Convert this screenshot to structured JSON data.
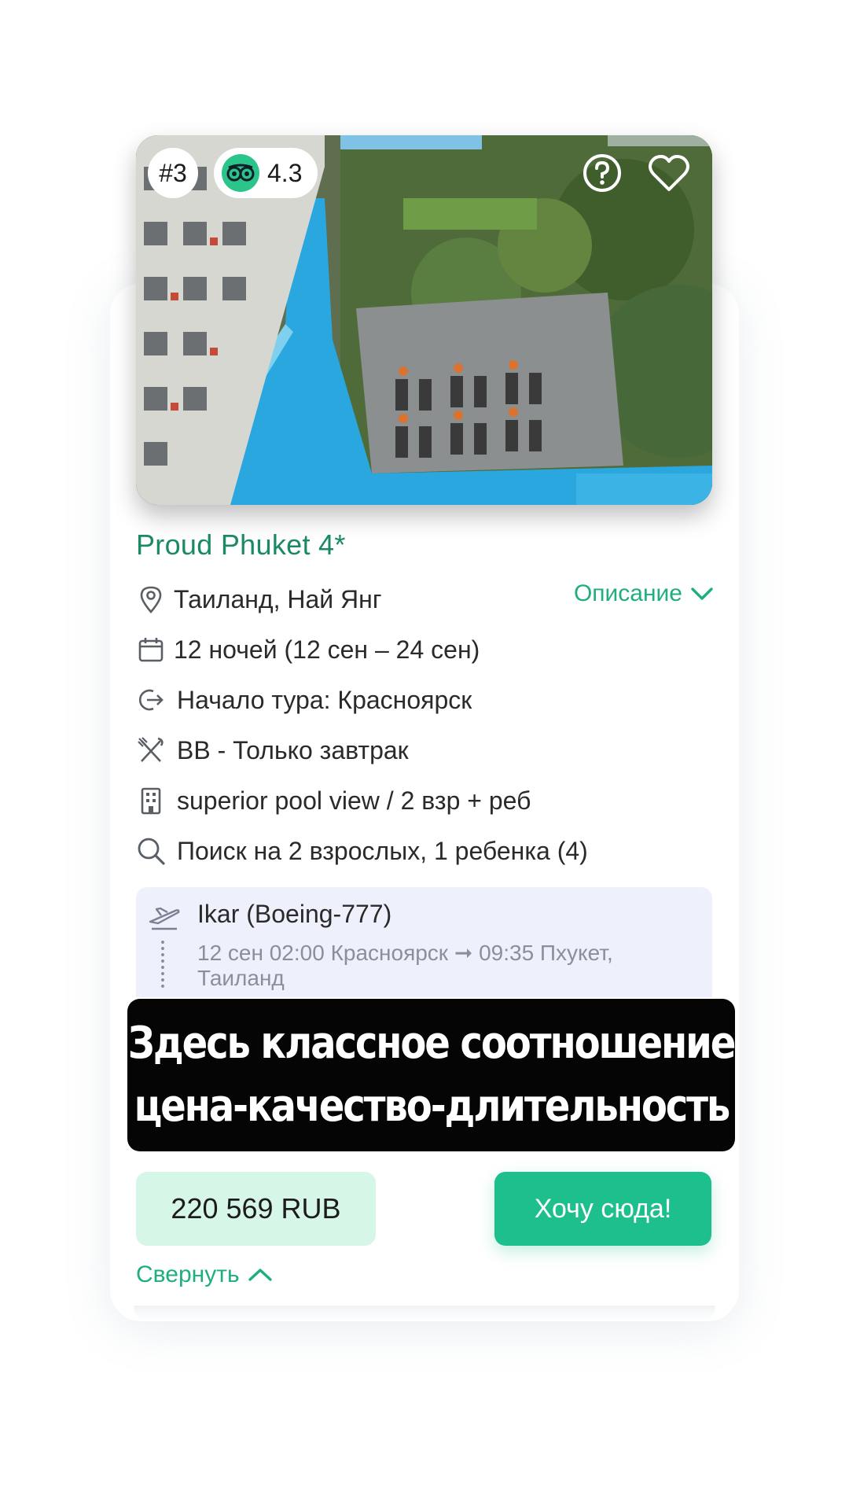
{
  "card": {
    "rank": "#3",
    "rating": "4.3",
    "hotel_name": "Proud Phuket 4*",
    "description_label": "Описание",
    "location": "Таиланд, Най Янг",
    "dates": "12 ночей (12 сен – 24 сен)",
    "departure": "Начало тура: Красноярск",
    "meal": "BB - Только завтрак",
    "room": "superior pool view / 2 взр + реб",
    "search": "Поиск на 2 взрослых, 1 ребенка (4)",
    "flight": {
      "airline": "Ikar (Boeing-777)",
      "route": "12 сен 02:00 Красноярск ➞ 09:35 Пхукет, Таиланд"
    },
    "price": "220 569 RUB",
    "cta_label": "Хочу сюда!",
    "collapse_label": "Свернуть"
  },
  "caption": {
    "line1": "Здесь классное соотношение",
    "line2": "цена-качество-длительность"
  },
  "icons": {
    "rating_logo": "tripadvisor-owl-icon",
    "help": "question-circle-icon",
    "favorite": "heart-icon",
    "location": "map-pin-icon",
    "dates": "calendar-icon",
    "departure": "exit-arrow-icon",
    "meal": "cutlery-icon",
    "room": "building-icon",
    "search": "search-icon",
    "flight": "plane-takeoff-icon"
  },
  "colors": {
    "accent": "#1fae80",
    "hotel_name": "#1a8a62",
    "cta_bg": "#1dbf8c",
    "price_bg": "#d6f7e8",
    "flight_bg": "#eef0fb",
    "caption_bg": "#050505"
  }
}
